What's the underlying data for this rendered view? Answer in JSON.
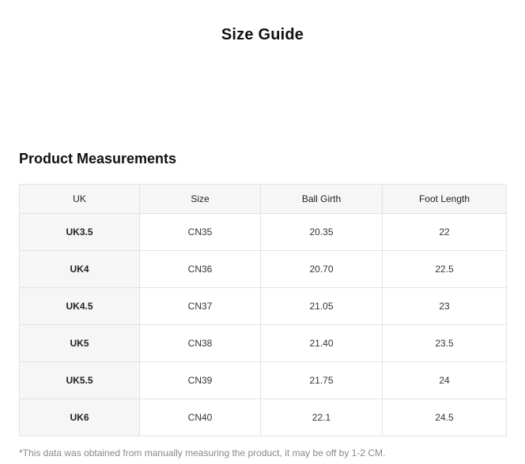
{
  "page": {
    "title": "Size Guide"
  },
  "section": {
    "title": "Product Measurements"
  },
  "table": {
    "headers": [
      "UK",
      "Size",
      "Ball Girth",
      "Foot Length"
    ],
    "rows": [
      [
        "UK3.5",
        "CN35",
        "20.35",
        "22"
      ],
      [
        "UK4",
        "CN36",
        "20.70",
        "22.5"
      ],
      [
        "UK4.5",
        "CN37",
        "21.05",
        "23"
      ],
      [
        "UK5",
        "CN38",
        "21.40",
        "23.5"
      ],
      [
        "UK5.5",
        "CN39",
        "21.75",
        "24"
      ],
      [
        "UK6",
        "CN40",
        "22.1",
        "24.5"
      ]
    ]
  },
  "footnote": "*This data was obtained from manually measuring the product, it may be off by 1-2 CM.",
  "colors": {
    "header_bg": "#f6f6f6",
    "border": "#e3e3e3",
    "footnote_text": "#888888"
  }
}
